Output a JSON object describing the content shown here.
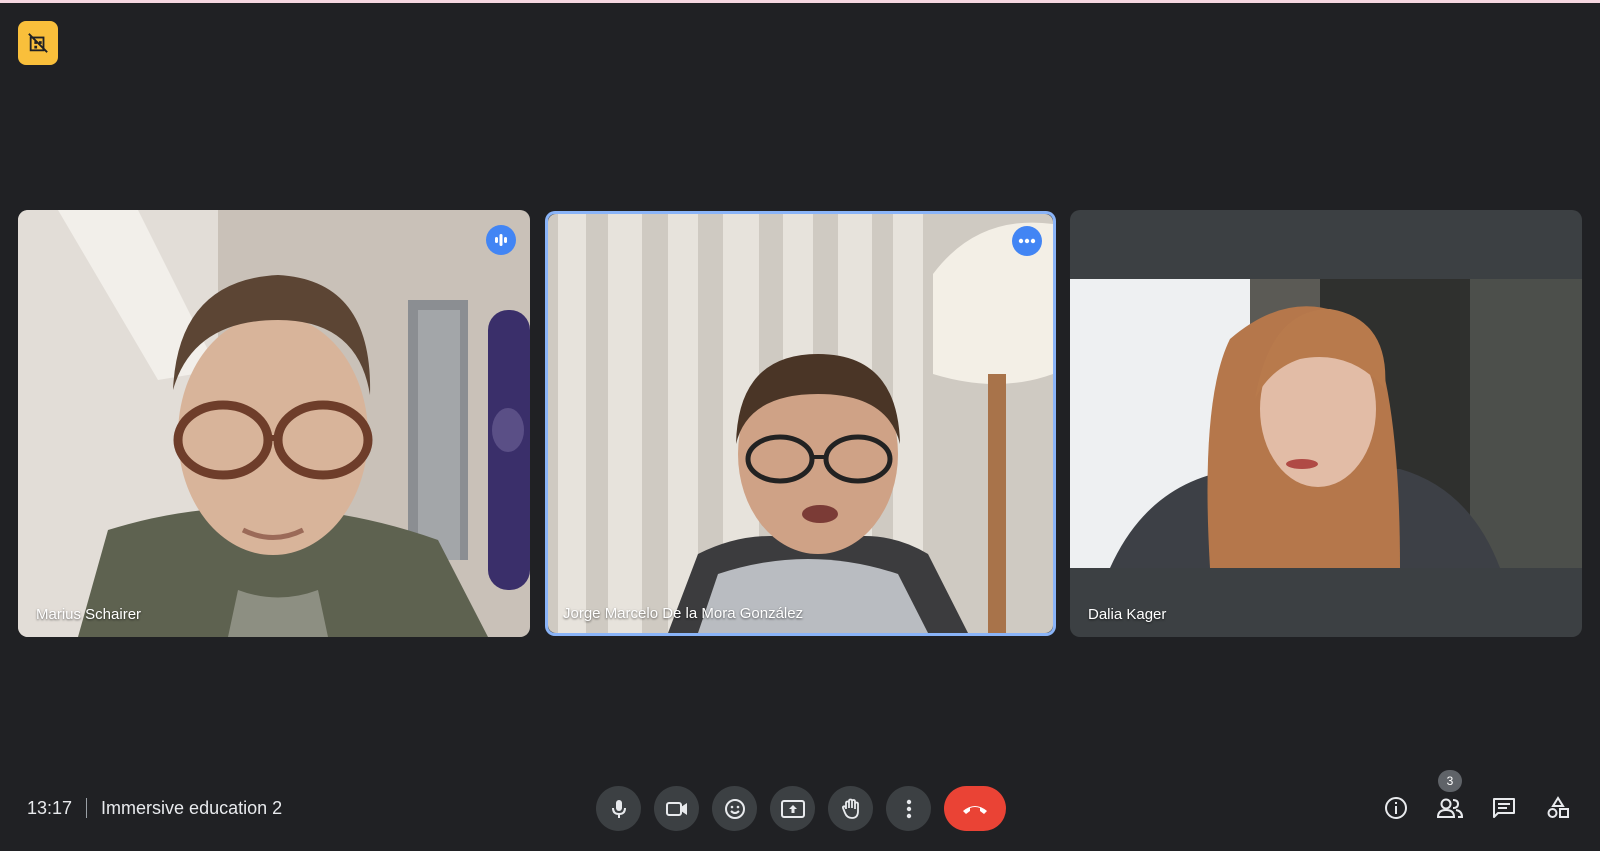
{
  "meeting": {
    "time": "13:17",
    "title": "Immersive education 2"
  },
  "participants": [
    {
      "name": "Marius Schairer",
      "status_icon": "speaking-indicator-icon"
    },
    {
      "name": "Jorge Marcelo De la Mora González",
      "status_icon": "more-options-icon"
    },
    {
      "name": "Dalia Kager"
    }
  ],
  "controls": {
    "mic": "mic-icon",
    "camera": "camera-icon",
    "reactions": "emoji-icon",
    "present": "present-screen-icon",
    "raise_hand": "raise-hand-icon",
    "more": "more-vert-icon",
    "leave": "end-call-icon"
  },
  "side_panel": {
    "info": "info-icon",
    "people": "people-icon",
    "people_count": "3",
    "chat": "chat-icon",
    "activities": "activities-icon"
  },
  "colors": {
    "background": "#202124",
    "tile": "#3c4043",
    "accent": "#4285f4",
    "highlight": "#8ab4f8",
    "end_call": "#ea4335",
    "badge": "#f9bf3b"
  }
}
